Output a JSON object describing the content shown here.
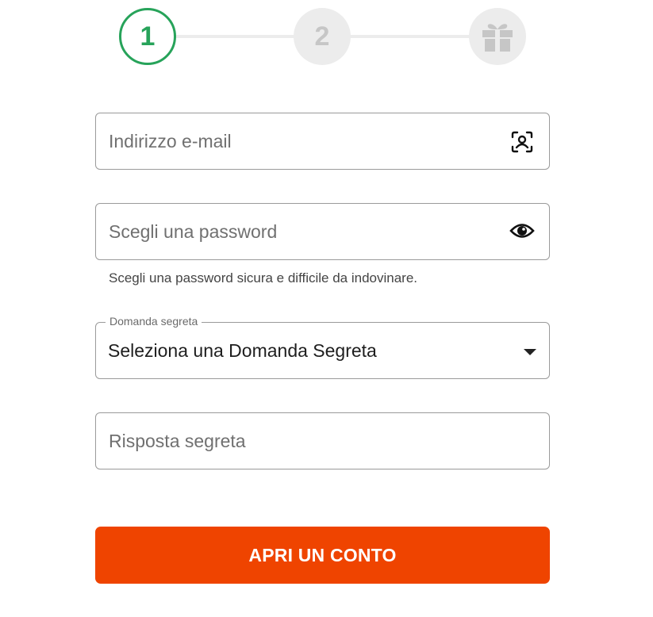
{
  "stepper": {
    "steps": [
      {
        "label": "1",
        "state": "active"
      },
      {
        "label": "2",
        "state": "pending"
      },
      {
        "icon": "gift-icon",
        "state": "pending"
      }
    ],
    "colors": {
      "active": "#27a35a",
      "inactive_bg": "#ececec",
      "inactive_text": "#c6c6c6"
    }
  },
  "form": {
    "email": {
      "value": "",
      "placeholder": "Indirizzo e-mail",
      "icon": "face-scan-icon"
    },
    "password": {
      "value": "",
      "placeholder": "Scegli una password",
      "icon": "eye-icon",
      "helper": "Scegli una password sicura e difficile da indovinare."
    },
    "secret_question": {
      "label": "Domanda segreta",
      "selected": "Seleziona una Domanda Segreta",
      "icon": "caret-down-icon"
    },
    "secret_answer": {
      "value": "",
      "placeholder": "Risposta segreta"
    },
    "submit": {
      "label": "APRI UN CONTO",
      "color": "#ef4400"
    }
  }
}
